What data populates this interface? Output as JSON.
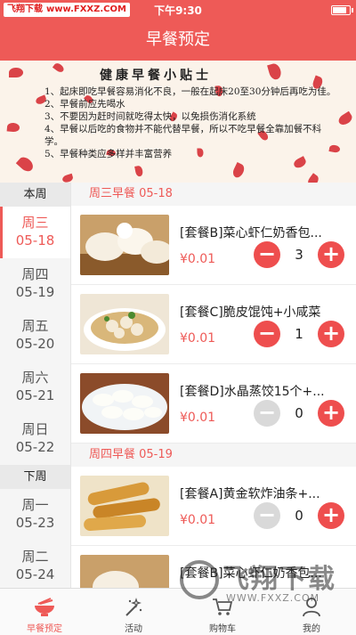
{
  "status_bar": {
    "watermark_left": "飞翔下载",
    "watermark_url": "www.FXXZ.COM",
    "time": "下午9:30",
    "battery_level": 0.9
  },
  "navbar": {
    "title": "早餐预定"
  },
  "banner": {
    "title": "健康早餐小贴士",
    "tips": [
      "1、起床即吃早餐容易消化不良，一般在起床20至30分钟后再吃为佳。",
      "2、早餐前应先喝水",
      "3、不要因为赶时间就吃得太快，以免损伤消化系统",
      "4、早餐以后吃的食物并不能代替早餐，所以不吃早餐全靠加餐不科学。",
      "5、早餐种类应多样并丰富营养"
    ]
  },
  "sidebar": {
    "groups": [
      {
        "label": "本周",
        "days": [
          {
            "weekday": "周三",
            "date": "05-18",
            "active": true
          },
          {
            "weekday": "周四",
            "date": "05-19",
            "active": false
          },
          {
            "weekday": "周五",
            "date": "05-20",
            "active": false
          },
          {
            "weekday": "周六",
            "date": "05-21",
            "active": false
          },
          {
            "weekday": "周日",
            "date": "05-22",
            "active": false
          }
        ]
      },
      {
        "label": "下周",
        "days": [
          {
            "weekday": "周一",
            "date": "05-23",
            "active": false
          },
          {
            "weekday": "周二",
            "date": "05-24",
            "active": false
          }
        ]
      }
    ]
  },
  "sections": [
    {
      "header": "周三早餐 05-18",
      "items": [
        {
          "name": "[套餐B]菜心虾仁奶香包...",
          "price": "¥0.01",
          "qty": "3",
          "image": "steamed-bun-image",
          "minus_enabled": true
        },
        {
          "name": "[套餐C]脆皮馄饨+小咸菜",
          "price": "¥0.01",
          "qty": "1",
          "image": "wonton-soup-image",
          "minus_enabled": true
        },
        {
          "name": "[套餐D]水晶蒸饺15个+...",
          "price": "¥0.01",
          "qty": "0",
          "image": "dumplings-image",
          "minus_enabled": false
        }
      ]
    },
    {
      "header": "周四早餐 05-19",
      "items": [
        {
          "name": "[套餐A]黄金软炸油条+...",
          "price": "¥0.01",
          "qty": "0",
          "image": "fried-dough-image",
          "minus_enabled": false
        },
        {
          "name": "[套餐B]菜心虾仁奶香包...",
          "price": "",
          "qty": "",
          "image": "steamed-bun-image",
          "minus_enabled": false
        }
      ]
    }
  ],
  "controls": {
    "minus": "−",
    "plus": "+"
  },
  "tabbar": {
    "tabs": [
      {
        "label": "早餐预定",
        "icon": "bowl-icon",
        "active": true
      },
      {
        "label": "活动",
        "icon": "magic-wand-icon",
        "active": false
      },
      {
        "label": "购物车",
        "icon": "cart-icon",
        "active": false
      },
      {
        "label": "我的",
        "icon": "user-icon",
        "active": false
      }
    ]
  },
  "bottom_watermark": {
    "text": "飞翔下载",
    "url": "WWW.FXXZ.COM"
  },
  "colors": {
    "brand": "#ee5a57",
    "button": "#ee4e4e",
    "disabled": "#d9d9d9"
  }
}
